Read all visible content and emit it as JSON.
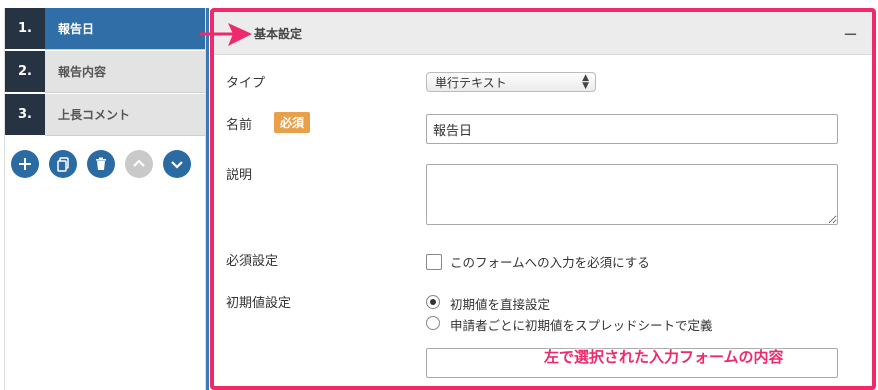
{
  "sidebar": {
    "items": [
      {
        "num": "1.",
        "label": "報告日"
      },
      {
        "num": "2.",
        "label": "報告内容"
      },
      {
        "num": "3.",
        "label": "上長コメント"
      }
    ]
  },
  "panel": {
    "title": "基本設定",
    "collapse": "−"
  },
  "form": {
    "type_label": "タイプ",
    "type_value": "単行テキスト",
    "name_label": "名前",
    "required_badge": "必須",
    "name_value": "報告日",
    "desc_label": "説明",
    "desc_value": "",
    "required_setting_label": "必須設定",
    "required_checkbox_text": "このフォームへの入力を必須にする",
    "initial_label": "初期値設定",
    "initial_options": [
      "初期値を直接設定",
      "申請者ごとに初期値をスプレッドシートで定義"
    ],
    "initial_value": ""
  },
  "annotation": "左で選択された入力フォームの内容",
  "colors": {
    "accent": "#2f6ea7",
    "highlight": "#ee2a6b",
    "badge": "#e8a04a",
    "dark": "#263342"
  }
}
